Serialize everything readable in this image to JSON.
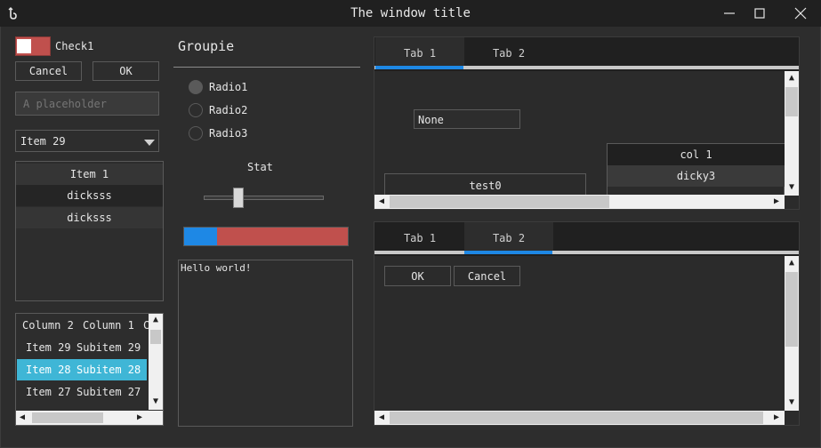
{
  "window": {
    "title": "The window title"
  },
  "left": {
    "check_label": "Check1",
    "cancel_label": "Cancel",
    "ok_label": "OK",
    "placeholder": "A placeholder",
    "combo_value": "Item 29",
    "list_items": [
      "Item 1",
      "dicksss",
      "dicksss"
    ],
    "table": {
      "columns": [
        "Column 2",
        "Column 1",
        "C"
      ],
      "rows": [
        {
          "c1": "Item 29",
          "c2": "Subitem 29"
        },
        {
          "c1": "Item 28",
          "c2": "Subitem 28"
        },
        {
          "c1": "Item 27",
          "c2": "Subitem 27"
        }
      ]
    }
  },
  "middle": {
    "group_title": "Groupie",
    "radios": [
      "Radio1",
      "Radio2",
      "Radio3"
    ],
    "slider_label": "Stat",
    "slider_value": 0.27,
    "progress_value": 0.2,
    "text": "Hello world!"
  },
  "right": {
    "top_tabs": [
      "Tab 1",
      "Tab 2"
    ],
    "top_field": "None",
    "top_button": "test0",
    "top_table": {
      "col": "col 1",
      "cell": "dicky3"
    },
    "bottom_tabs": [
      "Tab 1",
      "Tab 2"
    ],
    "ok_label": "OK",
    "cancel_label": "Cancel"
  },
  "colors": {
    "accent": "#1e88e5",
    "danger": "#c0504d",
    "selection": "#3fb6d6"
  }
}
